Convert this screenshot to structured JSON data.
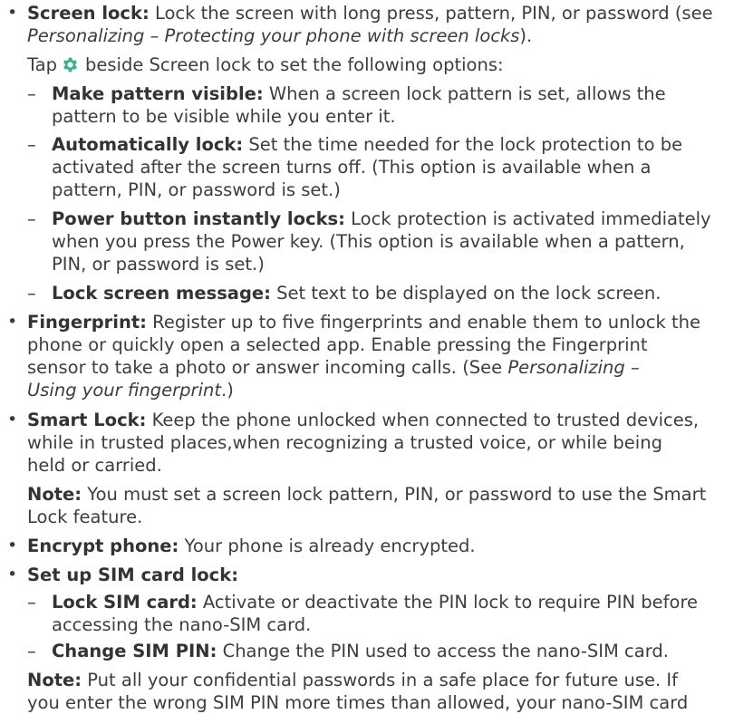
{
  "bullets": {
    "screen_lock": {
      "title": "Screen lock:",
      "body_1": " Lock the screen with long press, pattern, PIN, or password (see",
      "body_2_italic": "Personalizing – Protecting your phone with screen locks",
      "body_2_end": ").",
      "tap_before": "Tap",
      "tap_after": "beside Screen lock to set the following options:",
      "gear_color": "#3bb08f",
      "gear_icon": "settings-gear-icon",
      "options": [
        {
          "title": "Make pattern visible:",
          "line_1": " When a screen lock pattern is set, allows the",
          "line_2": "pattern to be visible while you enter it."
        },
        {
          "title": "Automatically lock:",
          "line_1": " Set the time needed for the lock protection to be",
          "line_2": "activated after the screen turns off. (This option is available when a",
          "line_3": "pattern, PIN, or password is set.)"
        },
        {
          "title": "Power button instantly locks:",
          "line_1": " Lock protection is activated immediately",
          "line_2": "when you press the Power key. (This option is available when a pattern,",
          "line_3": "PIN, or password is set.)"
        },
        {
          "title": "Lock screen message:",
          "line_1": " Set text to be displayed on the lock screen."
        }
      ]
    },
    "fingerprint": {
      "title": "Fingerprint:",
      "line_1": " Register up to five fingerprints and enable them to unlock the",
      "line_2": "phone or quickly open a selected app. Enable pressing the Fingerprint",
      "line_3_a": "sensor to take a photo or answer incoming calls. (See ",
      "line_3_italic": "Personalizing –",
      "line_4_italic": "Using your fingerprint",
      "line_4_end": ".)"
    },
    "smart_lock": {
      "title": "Smart Lock:",
      "line_1": " Keep the phone unlocked when connected to trusted devices,",
      "line_2": "while in trusted places,when recognizing a trusted voice, or while being",
      "line_3": "held or carried.",
      "note_title": "Note:",
      "note_line_1": " You must set a screen lock pattern, PIN, or password to use the Smart",
      "note_line_2": "Lock feature."
    },
    "encrypt": {
      "title": "Encrypt phone:",
      "line_1": " Your phone is already encrypted."
    },
    "sim_lock": {
      "title": "Set up SIM card lock:",
      "options": [
        {
          "title": "Lock SIM card:",
          "line_1": " Activate or deactivate the PIN lock to require PIN before",
          "line_2": "accessing the nano-SIM card."
        },
        {
          "title": "Change SIM PIN:",
          "line_1": " Change the PIN used to access the nano-SIM card."
        }
      ],
      "note_title": "Note:",
      "note_line_1": " Put all your confidential passwords in a safe place for future use. If",
      "note_line_2": "you enter the wrong SIM PIN more times than allowed, your nano-SIM card"
    }
  },
  "bullet_char": "•",
  "dash_char": "–"
}
